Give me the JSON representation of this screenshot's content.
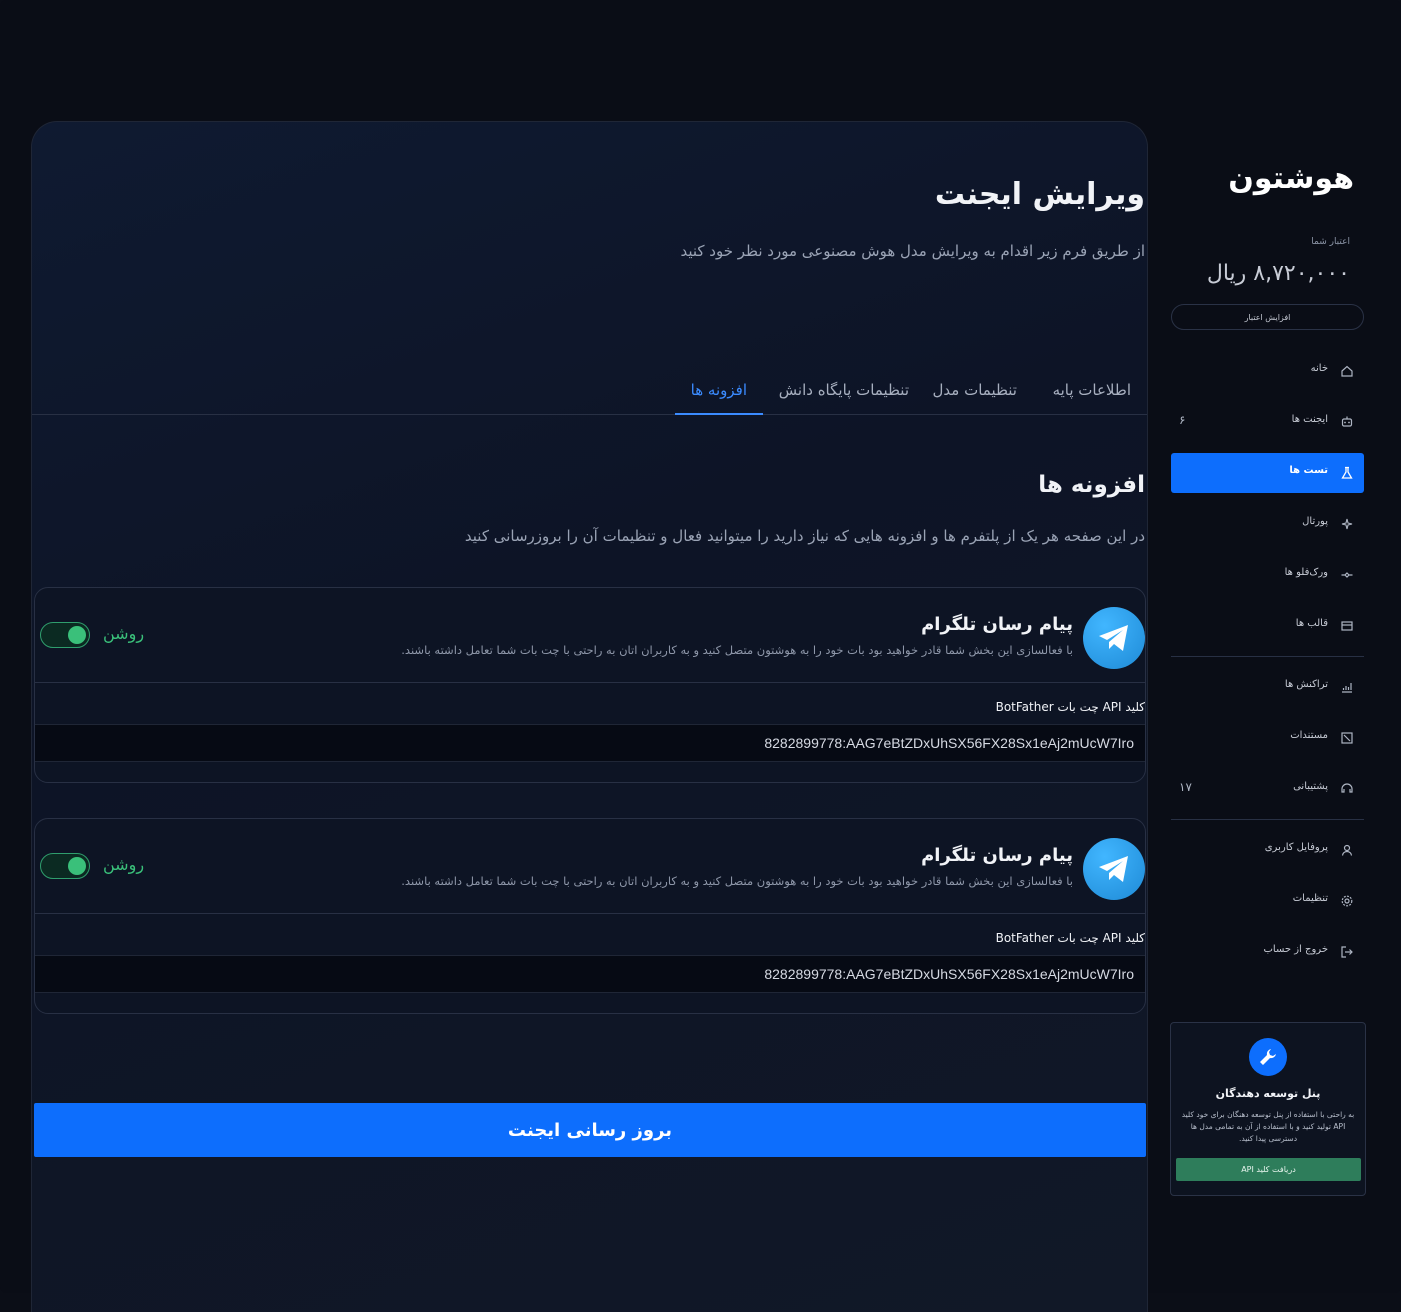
{
  "page": {
    "title": "ویرایش ایجنت",
    "subtitle": "از طریق فرم زیر اقدام به ویرایش مدل هوش مصنوعی مورد نظر خود کنید"
  },
  "tabs": [
    {
      "label": "اطلاعات پایه",
      "active": false
    },
    {
      "label": "تنظیمات مدل",
      "active": false
    },
    {
      "label": "تنظیمات پایگاه دانش",
      "active": false
    },
    {
      "label": "افزونه ها",
      "active": true
    }
  ],
  "section": {
    "title": "افزونه ها",
    "subtitle": "در این صفحه هر یک از پلتفرم ها و افزونه هایی که نیاز دارید را میتوانید فعال و تنظیمات آن را بروزرسانی کنید"
  },
  "plugins": [
    {
      "title": "پیام رسان تلگرام",
      "description": "با فعالسازی این بخش شما قادر خواهید بود بات خود را به هوشتون متصل کنید و به کاربران اتان به راحتی با چت بات شما تعامل داشته باشند.",
      "toggle_label": "روشن",
      "enabled": true,
      "field_label": "کلید API چت بات BotFather",
      "field_value": "8282899778:AAG7eBtZDxUhSX56FX28Sx1eAj2mUcW7Iro",
      "icon": "telegram-icon"
    },
    {
      "title": "پیام رسان تلگرام",
      "description": "با فعالسازی این بخش شما قادر خواهید بود بات خود را به هوشتون متصل کنید و به کاربران اتان به راحتی با چت بات شما تعامل داشته باشند.",
      "toggle_label": "روشن",
      "enabled": true,
      "field_label": "کلید API چت بات BotFather",
      "field_value": "8282899778:AAG7eBtZDxUhSX56FX28Sx1eAj2mUcW7Iro",
      "icon": "telegram-icon"
    }
  ],
  "submit_label": "بروز رسانی ایجنت",
  "sidebar": {
    "logo": "هوشتون",
    "credit_label": "اعتبار شما",
    "credit_value": "۸,۷۲۰,۰۰۰ ریال",
    "add_credit": "افزایش اعتبار",
    "items": [
      {
        "label": "خانه",
        "icon": "home-icon",
        "count": ""
      },
      {
        "label": "ایجنت ها",
        "icon": "robot-icon",
        "count": "۶"
      },
      {
        "label": "تست ها",
        "icon": "flask-icon",
        "count": "",
        "active": true
      },
      {
        "label": "پورتال",
        "icon": "sparkle-icon",
        "count": ""
      },
      {
        "label": "ورک‌فلو ها",
        "icon": "workflow-icon",
        "count": ""
      },
      {
        "label": "قالب ها",
        "icon": "template-icon",
        "count": ""
      },
      {
        "label": "تراکنش ها",
        "icon": "chart-icon",
        "count": ""
      },
      {
        "label": "مستندات",
        "icon": "docs-icon",
        "count": ""
      },
      {
        "label": "پشتیبانی",
        "icon": "support-icon",
        "count": "۱۷"
      },
      {
        "label": "پروفایل کاربری",
        "icon": "user-icon",
        "count": ""
      },
      {
        "label": "تنظیمات",
        "icon": "gear-icon",
        "count": ""
      },
      {
        "label": "خروج از حساب",
        "icon": "logout-icon",
        "count": ""
      }
    ],
    "dev_card": {
      "title": "پنل توسعه دهندگان",
      "text": "به راحتی با استفاده از پنل توسعه دهنگان برای خود کلید API تولید کنید و با استفاده از آن به تمامی مدل ها دسترسی پیدا کنید.",
      "button": "دریافت کلید API",
      "icon": "wrench-icon"
    }
  },
  "colors": {
    "accent": "#0d6efd",
    "toggle_on": "#3ac07a",
    "dev_button": "#2e7d5b",
    "background": "#0a0d16"
  }
}
